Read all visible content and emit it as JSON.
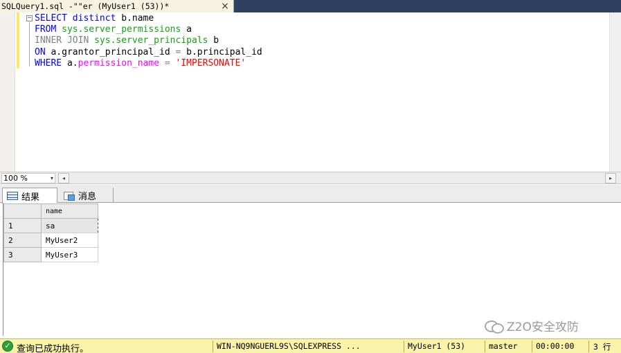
{
  "tab": {
    "title": "SQLQuery1.sql -\"\"er (MyUser1 (53))*",
    "close_icon": "close-icon",
    "close_glyph": "×"
  },
  "editor": {
    "collapse_glyph": "−",
    "lines": [
      [
        {
          "t": "SELECT distinct ",
          "c": "kw"
        },
        {
          "t": "b.name",
          "c": "txt"
        }
      ],
      [
        {
          "t": "FROM ",
          "c": "kw"
        },
        {
          "t": "sys.server_permissions",
          "c": "obj"
        },
        {
          "t": " a",
          "c": "txt"
        }
      ],
      [
        {
          "t": "INNER JOIN ",
          "c": "op"
        },
        {
          "t": "sys.server_principals",
          "c": "obj"
        },
        {
          "t": " b",
          "c": "txt"
        }
      ],
      [
        {
          "t": "ON ",
          "c": "kw"
        },
        {
          "t": "a.grantor_principal_id ",
          "c": "txt"
        },
        {
          "t": "=",
          "c": "op"
        },
        {
          "t": " b.principal_id",
          "c": "txt"
        }
      ],
      [
        {
          "t": "WHERE ",
          "c": "kw"
        },
        {
          "t": "a.",
          "c": "txt"
        },
        {
          "t": "permission_name",
          "c": "fn"
        },
        {
          "t": " = ",
          "c": "op"
        },
        {
          "t": "'IMPERSONATE'",
          "c": "str"
        }
      ]
    ]
  },
  "zoom": {
    "value": "100 %",
    "arrow": "▾"
  },
  "scroll": {
    "left_arrow": "◂",
    "right_arrow": "▸"
  },
  "results_tabs": {
    "results_label": "结果",
    "messages_label": "消息"
  },
  "grid": {
    "column": "name",
    "rows": [
      {
        "num": "1",
        "name": "sa"
      },
      {
        "num": "2",
        "name": "MyUser2"
      },
      {
        "num": "3",
        "name": "MyUser3"
      }
    ]
  },
  "watermark": {
    "text": "Z2O安全攻防"
  },
  "status": {
    "icon_glyph": "✓",
    "message": "查询已成功执行。",
    "server": "WIN-NQ9NGUERL9S\\SQLEXPRESS ...",
    "user": "MyUser1 (53)",
    "database": "master",
    "elapsed": "00:00:00",
    "rows": "3 行"
  },
  "colors": {
    "keyword": "#0000ff",
    "object": "#16a016",
    "function": "#ff00ff",
    "string": "#ff0000",
    "operator": "#808080",
    "status_bar": "#f8f3a8",
    "tab_strip": "#2f3f5e"
  }
}
